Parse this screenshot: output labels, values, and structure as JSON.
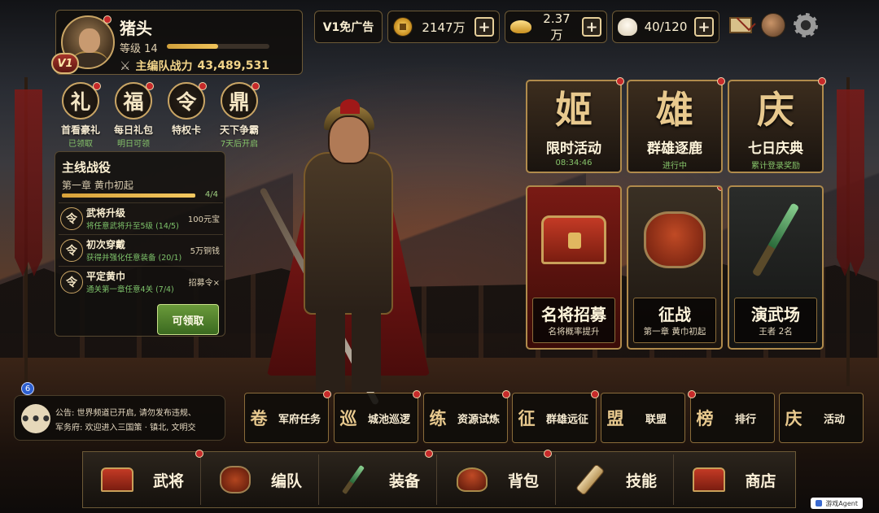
{
  "player": {
    "name": "猪头",
    "level_label": "等级 14",
    "level_progress": 0.5,
    "vip": "V1",
    "power_label": "主编队战力",
    "power_value": "43,489,531"
  },
  "topbar": {
    "vip_ad_label": "V1免广告",
    "resources": [
      {
        "icon": "copper-coin-icon",
        "value": "2147万"
      },
      {
        "icon": "gold-ingot-icon",
        "value": "2.37万"
      },
      {
        "icon": "steamed-bun-icon",
        "value": "40/120"
      }
    ],
    "plus_symbol": "+"
  },
  "shortcuts": [
    {
      "glyph": "礼",
      "label": "首看豪礼",
      "sub": "已领取"
    },
    {
      "glyph": "福",
      "label": "每日礼包",
      "sub": "明日可领"
    },
    {
      "glyph": "令",
      "label": "特权卡",
      "sub": ""
    },
    {
      "glyph": "鼎",
      "label": "天下争霸",
      "sub": "7天后开启"
    }
  ],
  "quest": {
    "title": "主线战役",
    "chapter": "第一章  黄巾初起",
    "progress_text": "4/4",
    "progress": 1.0,
    "tasks": [
      {
        "glyph": "令",
        "name": "武将升级",
        "desc": "将任意武将升至5级 (14/5)",
        "reward": "100元宝"
      },
      {
        "glyph": "令",
        "name": "初次穿戴",
        "desc": "获得并强化任意装备 (20/1)",
        "reward": "5万铜钱"
      },
      {
        "glyph": "令",
        "name": "平定黄巾",
        "desc": "通关第一章任意4关 (7/4)",
        "reward": "招募令×"
      }
    ],
    "claim_label": "可领取"
  },
  "events": [
    {
      "glyph": "姬",
      "title": "限时活动",
      "sub": "08:34:46"
    },
    {
      "glyph": "雄",
      "title": "群雄逐鹿",
      "sub": "进行中"
    },
    {
      "glyph": "庆",
      "title": "七日庆典",
      "sub": "累计登录奖励"
    }
  ],
  "features": [
    {
      "title": "名将招募",
      "sub": "名将概率提升"
    },
    {
      "title": "征战",
      "sub": "第一章 黄巾初起"
    },
    {
      "title": "演武场",
      "sub": "王者 2名"
    }
  ],
  "chat": {
    "line1": "公告: 世界频道已开启, 请勿发布违规、",
    "line2": "军务府: 欢迎进入三国策 · 镇北, 文明交",
    "bubble_glyph": "•••",
    "badge": "6"
  },
  "functions": [
    {
      "glyph": "卷",
      "label": "军府任务"
    },
    {
      "glyph": "巡",
      "label": "城池巡逻"
    },
    {
      "glyph": "练",
      "label": "资源试炼"
    },
    {
      "glyph": "征",
      "label": "群雄远征"
    },
    {
      "glyph": "盟",
      "label": "联盟"
    },
    {
      "glyph": "榜",
      "label": "排行"
    },
    {
      "glyph": "庆",
      "label": "活动"
    }
  ],
  "bottom_nav": [
    {
      "label": "武将",
      "icon": "chest-icon"
    },
    {
      "label": "编队",
      "icon": "drum-icon"
    },
    {
      "label": "装备",
      "icon": "sword-icon"
    },
    {
      "label": "背包",
      "icon": "helmet-bag-icon"
    },
    {
      "label": "技能",
      "icon": "scroll-icon"
    },
    {
      "label": "商店",
      "icon": "shop-chest-icon"
    }
  ],
  "agent_badge": "游戏Agent"
}
